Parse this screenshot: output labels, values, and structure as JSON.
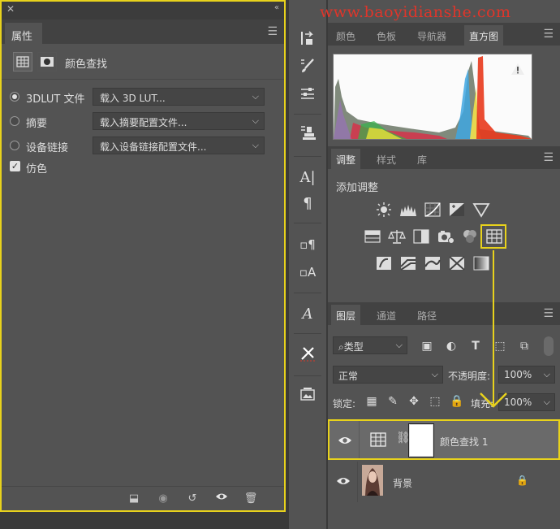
{
  "properties_panel": {
    "tab": "属性",
    "title": "颜色查找",
    "rows": [
      {
        "label": "3DLUT 文件",
        "value": "载入 3D LUT...",
        "selected": true
      },
      {
        "label": "摘要",
        "value": "载入摘要配置文件...",
        "selected": false
      },
      {
        "label": "设备链接",
        "value": "载入设备链接配置文件...",
        "selected": false
      }
    ],
    "dither_label": "仿色",
    "dither_checked": true
  },
  "watermark": "www.baoyidianshe.com",
  "top_tabs": [
    "颜色",
    "色板",
    "导航器",
    "直方图"
  ],
  "top_active": "直方图",
  "adj_tabs": [
    "调整",
    "样式",
    "库"
  ],
  "adj_active": "调整",
  "adj_title": "添加调整",
  "layers_tabs": [
    "图层",
    "通道",
    "路径"
  ],
  "layers_active": "图层",
  "filter_kind": "类型",
  "blend_mode": "正常",
  "opacity_label": "不透明度:",
  "opacity_value": "100%",
  "lock_label": "锁定:",
  "fill_label": "填充:",
  "fill_value": "100%",
  "layers": [
    {
      "name": "颜色查找 1",
      "type": "adjustment",
      "selected": true
    },
    {
      "name": "背景",
      "type": "image",
      "locked": true
    }
  ],
  "highlight_color": "#e8d21c",
  "watermark_color": "#e0352a"
}
